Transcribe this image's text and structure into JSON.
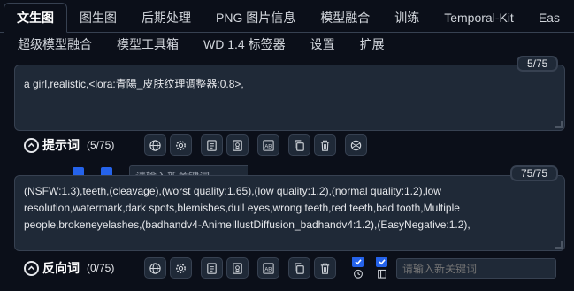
{
  "tabs_main": [
    {
      "label": "文生图",
      "active": true
    },
    {
      "label": "图生图"
    },
    {
      "label": "后期处理"
    },
    {
      "label": "PNG 图片信息"
    },
    {
      "label": "模型融合"
    },
    {
      "label": "训练"
    },
    {
      "label": "Temporal-Kit"
    },
    {
      "label": "Eas"
    }
  ],
  "tabs_secondary": [
    {
      "label": "超级模型融合"
    },
    {
      "label": "模型工具箱"
    },
    {
      "label": "WD 1.4 标签器"
    },
    {
      "label": "设置"
    },
    {
      "label": "扩展"
    }
  ],
  "positive": {
    "text": "a girl,realistic,<lora:青陽_皮肤纹理调整器:0.8>,",
    "token_count": "5/75",
    "label": "提示词",
    "count_label": "(5/75)"
  },
  "negative": {
    "text": "(NSFW:1.3),teeth,(cleavage),(worst quality:1.65),(low quality:1.2),(normal quality:1.2),low resolution,watermark,dark spots,blemishes,dull eyes,wrong teeth,red teeth,bad tooth,Multiple people,brokeneyelashes,(badhandv4-AnimeIllustDiffusion_badhandv4:1.2),(EasyNegative:1.2),",
    "token_count": "75/75",
    "label": "反向词",
    "count_label": "(0/75)",
    "keyword_placeholder": "请输入新关键词"
  },
  "ghost_placeholder": "请输入新关键词",
  "colors": {
    "background": "#0b0f19",
    "panel": "#1f2937",
    "border": "#374151",
    "accent": "#2563eb"
  },
  "icons": [
    "globe-icon",
    "gear-icon",
    "document-icon",
    "bookmark-icon",
    "translate-icon",
    "copy-icon",
    "trash-icon",
    "openai-icon",
    "history-icon",
    "panel-icon"
  ]
}
